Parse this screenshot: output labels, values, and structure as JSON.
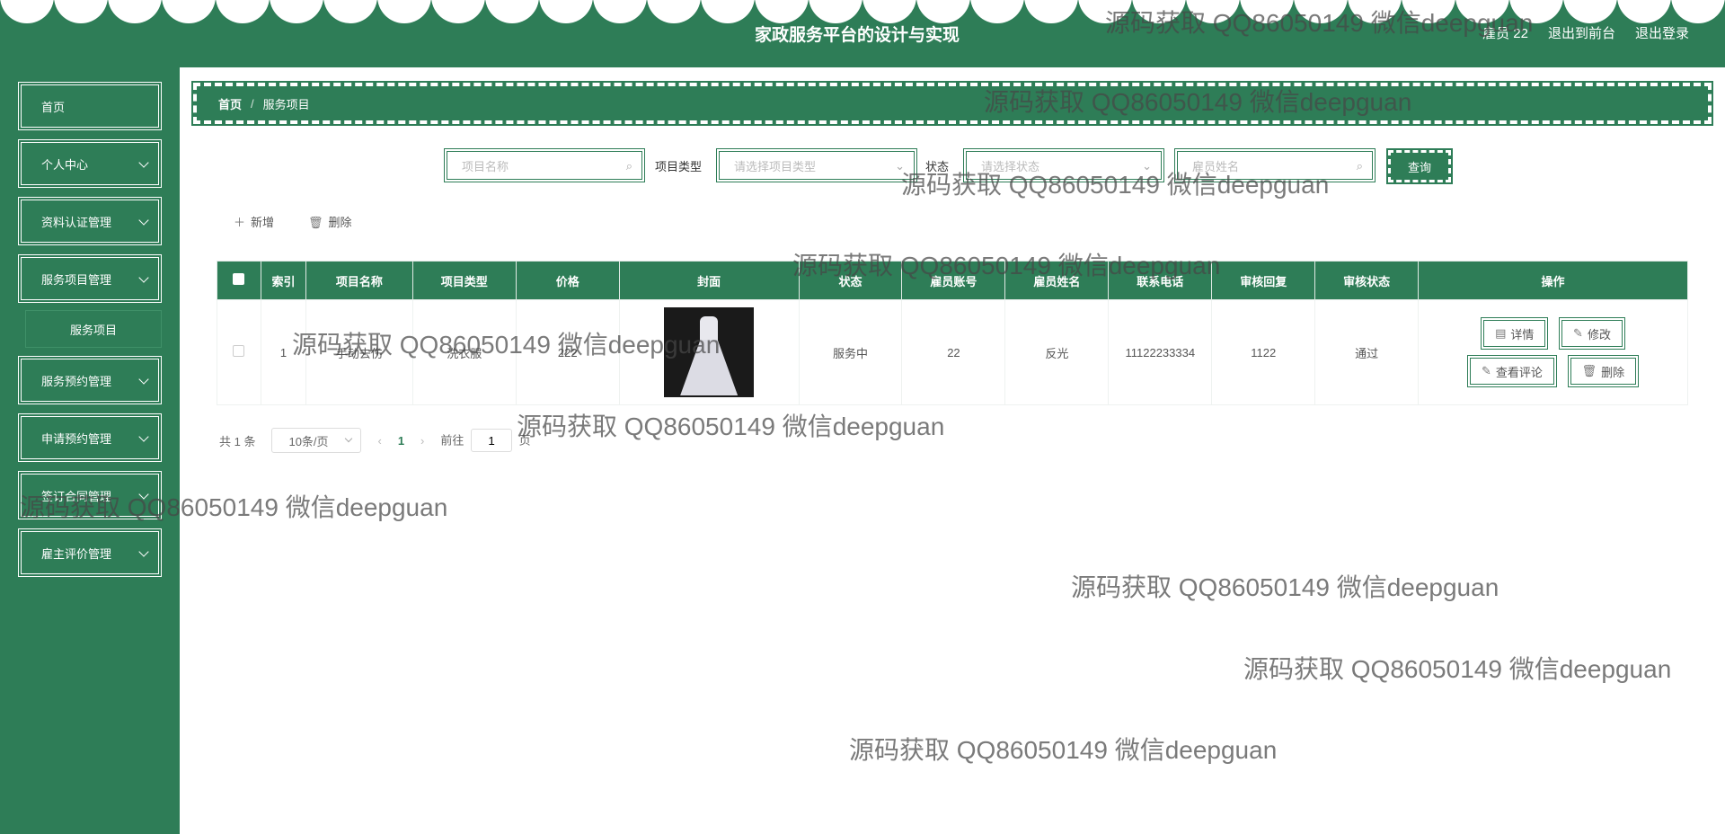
{
  "header": {
    "title": "家政服务平台的设计与实现",
    "user_label": "雇员 22",
    "back_to_front": "退出到前台",
    "logout": "退出登录"
  },
  "sidebar": {
    "items": [
      {
        "label": "首页",
        "has_chevron": false
      },
      {
        "label": "个人中心",
        "has_chevron": true
      },
      {
        "label": "资料认证管理",
        "has_chevron": true
      },
      {
        "label": "服务项目管理",
        "has_chevron": true
      },
      {
        "label": "服务预约管理",
        "has_chevron": true
      },
      {
        "label": "申请预约管理",
        "has_chevron": true
      },
      {
        "label": "签订合同管理",
        "has_chevron": true
      },
      {
        "label": "雇主评价管理",
        "has_chevron": true
      }
    ],
    "subitem": "服务项目"
  },
  "breadcrumb": {
    "home": "首页",
    "separator": "/",
    "current": "服务项目"
  },
  "search": {
    "name_placeholder": "项目名称",
    "type_label": "项目类型",
    "type_placeholder": "请选择项目类型",
    "status_label": "状态",
    "status_placeholder": "请选择状态",
    "employee_placeholder": "雇员姓名",
    "query_button": "查询"
  },
  "toolbar": {
    "add_label": "新增",
    "delete_label": "删除"
  },
  "table": {
    "headers": [
      "索引",
      "项目名称",
      "项目类型",
      "价格",
      "封面",
      "状态",
      "雇员账号",
      "雇员姓名",
      "联系电话",
      "审核回复",
      "审核状态",
      "操作"
    ],
    "rows": [
      {
        "index": "1",
        "name": "手动去伤",
        "type": "洗衣服",
        "price": "222",
        "status": "服务中",
        "account": "22",
        "employee_name": "反光",
        "phone": "11122233334",
        "reply": "1122",
        "audit_status": "通过"
      }
    ],
    "ops": {
      "detail": "详情",
      "edit": "修改",
      "comments": "查看评论",
      "delete": "删除"
    }
  },
  "pager": {
    "total": "共 1 条",
    "page_size": "10条/页",
    "current_page": "1",
    "goto_prefix": "前往",
    "goto_value": "1",
    "goto_suffix": "页"
  },
  "watermark": "源码获取 QQ86050149 微信deepguan",
  "colors": {
    "primary": "#2e7d57"
  }
}
